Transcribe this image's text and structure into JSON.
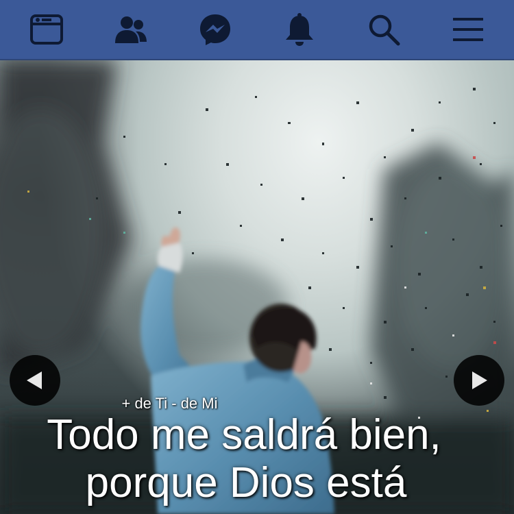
{
  "topbar": {
    "background_color": "#3b5998",
    "icons": [
      {
        "name": "news-feed-icon"
      },
      {
        "name": "friends-icon"
      },
      {
        "name": "messenger-icon"
      },
      {
        "name": "notifications-bell-icon"
      },
      {
        "name": "search-icon"
      },
      {
        "name": "menu-icon"
      }
    ]
  },
  "post_image": {
    "watermark": "+ de Ti - de Mi",
    "quote_line1": "Todo me saldrá bien,",
    "quote_line2": "porque Dios está",
    "prev_icon": "triangle-left-icon",
    "next_icon": "triangle-right-icon"
  }
}
